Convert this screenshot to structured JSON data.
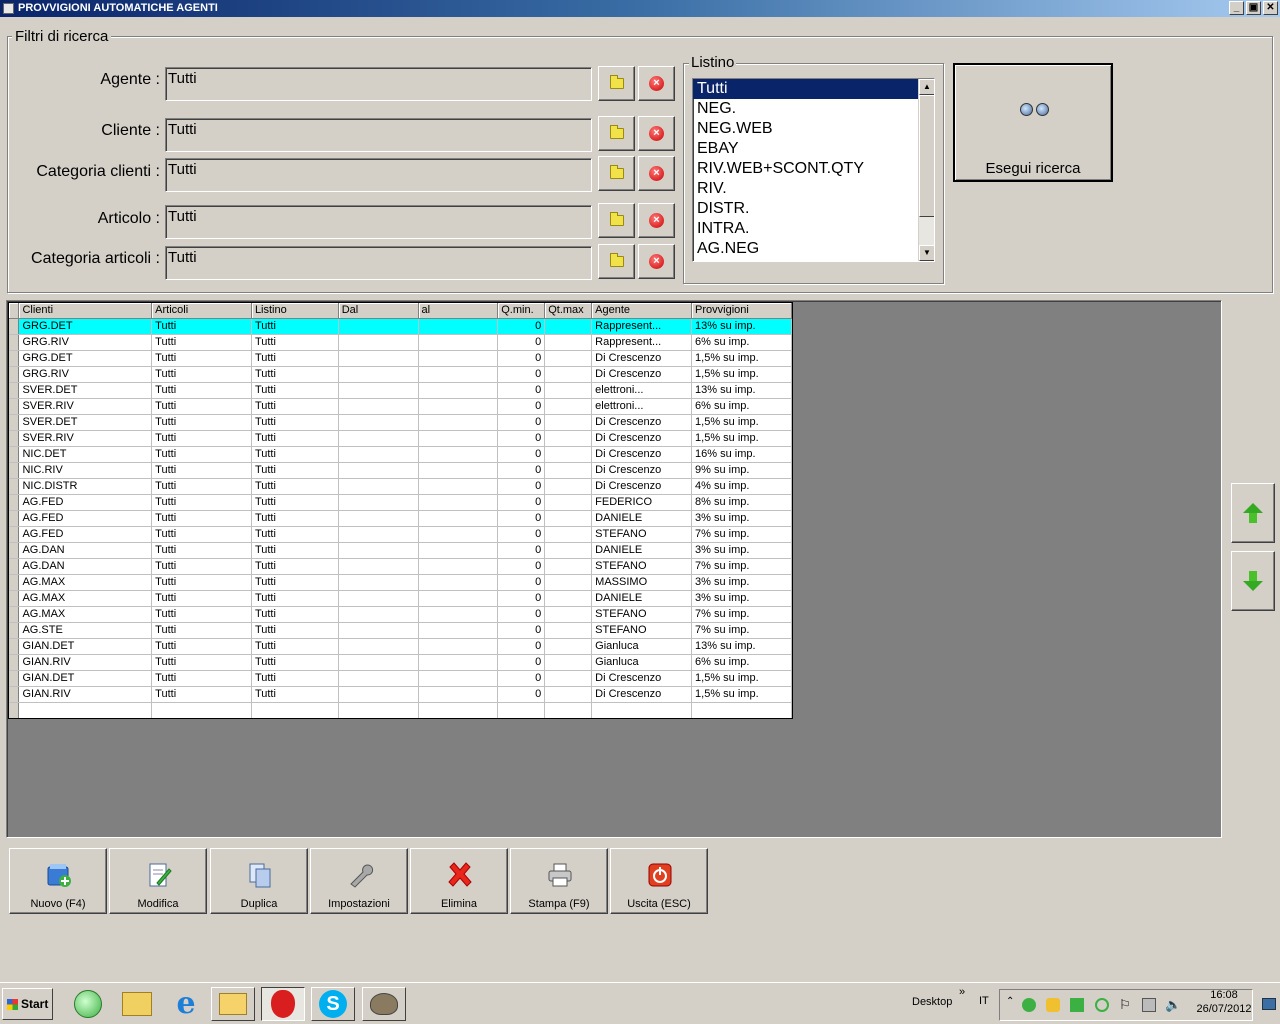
{
  "window": {
    "title": "PROVVIGIONI AUTOMATICHE AGENTI",
    "btn_min": "_",
    "btn_restore": "▣",
    "btn_close": "✕"
  },
  "filters": {
    "group_title": "Filtri di ricerca",
    "agente_label": "Agente :",
    "agente_value": "Tutti",
    "cliente_label": "Cliente :",
    "cliente_value": "Tutti",
    "catcli_label": "Categoria clienti :",
    "catcli_value": "Tutti",
    "articolo_label": "Articolo :",
    "articolo_value": "Tutti",
    "catart_label": "Categoria articoli :",
    "catart_value": "Tutti"
  },
  "listino": {
    "title": "Listino",
    "items": [
      "Tutti",
      "NEG.",
      "NEG.WEB",
      "EBAY",
      "RIV.WEB+SCONT.QTY",
      "RIV.",
      "DISTR.",
      "INTRA.",
      "AG.NEG"
    ],
    "selected_index": 0
  },
  "search": {
    "label": "Esegui ricerca",
    "icon": "binoculars-icon"
  },
  "grid": {
    "columns": [
      "Clienti",
      "Articoli",
      "Listino",
      "Dal",
      "al",
      "Q.min.",
      "Qt.max",
      "Agente",
      "Provvigioni"
    ],
    "rows": [
      [
        "GRG.DET",
        "Tutti",
        "Tutti",
        "",
        "",
        "0",
        "",
        "Rappresent...",
        "13% su imp."
      ],
      [
        "GRG.RIV",
        "Tutti",
        "Tutti",
        "",
        "",
        "0",
        "",
        "Rappresent...",
        "6% su imp."
      ],
      [
        "GRG.DET",
        "Tutti",
        "Tutti",
        "",
        "",
        "0",
        "",
        "Di Crescenzo",
        "1,5% su imp."
      ],
      [
        "GRG.RIV",
        "Tutti",
        "Tutti",
        "",
        "",
        "0",
        "",
        "Di Crescenzo",
        "1,5% su imp."
      ],
      [
        "SVER.DET",
        "Tutti",
        "Tutti",
        "",
        "",
        "0",
        "",
        "elettroni...",
        "13% su imp."
      ],
      [
        "SVER.RIV",
        "Tutti",
        "Tutti",
        "",
        "",
        "0",
        "",
        "elettroni...",
        "6% su imp."
      ],
      [
        "SVER.DET",
        "Tutti",
        "Tutti",
        "",
        "",
        "0",
        "",
        "Di Crescenzo",
        "1,5% su imp."
      ],
      [
        "SVER.RIV",
        "Tutti",
        "Tutti",
        "",
        "",
        "0",
        "",
        "Di Crescenzo",
        "1,5% su imp."
      ],
      [
        "NIC.DET",
        "Tutti",
        "Tutti",
        "",
        "",
        "0",
        "",
        "Di Crescenzo",
        "16% su imp."
      ],
      [
        "NIC.RIV",
        "Tutti",
        "Tutti",
        "",
        "",
        "0",
        "",
        "Di Crescenzo",
        "9% su imp."
      ],
      [
        "NIC.DISTR",
        "Tutti",
        "Tutti",
        "",
        "",
        "0",
        "",
        "Di Crescenzo",
        "4% su imp."
      ],
      [
        "AG.FED",
        "Tutti",
        "Tutti",
        "",
        "",
        "0",
        "",
        "FEDERICO",
        "8% su imp."
      ],
      [
        "AG.FED",
        "Tutti",
        "Tutti",
        "",
        "",
        "0",
        "",
        "DANIELE",
        "3% su imp."
      ],
      [
        "AG.FED",
        "Tutti",
        "Tutti",
        "",
        "",
        "0",
        "",
        "STEFANO",
        "7% su imp."
      ],
      [
        "AG.DAN",
        "Tutti",
        "Tutti",
        "",
        "",
        "0",
        "",
        "DANIELE",
        "3% su imp."
      ],
      [
        "AG.DAN",
        "Tutti",
        "Tutti",
        "",
        "",
        "0",
        "",
        "STEFANO",
        "7% su imp."
      ],
      [
        "AG.MAX",
        "Tutti",
        "Tutti",
        "",
        "",
        "0",
        "",
        "MASSIMO",
        "3% su imp."
      ],
      [
        "AG.MAX",
        "Tutti",
        "Tutti",
        "",
        "",
        "0",
        "",
        "DANIELE",
        "3% su imp."
      ],
      [
        "AG.MAX",
        "Tutti",
        "Tutti",
        "",
        "",
        "0",
        "",
        "STEFANO",
        "7% su imp."
      ],
      [
        "AG.STE",
        "Tutti",
        "Tutti",
        "",
        "",
        "0",
        "",
        "STEFANO",
        "7% su imp."
      ],
      [
        "GIAN.DET",
        "Tutti",
        "Tutti",
        "",
        "",
        "0",
        "",
        "Gianluca",
        "13% su imp."
      ],
      [
        "GIAN.RIV",
        "Tutti",
        "Tutti",
        "",
        "",
        "0",
        "",
        "Gianluca",
        "6% su imp."
      ],
      [
        "GIAN.DET",
        "Tutti",
        "Tutti",
        "",
        "",
        "0",
        "",
        "Di Crescenzo",
        "1,5% su imp."
      ],
      [
        "GIAN.RIV",
        "Tutti",
        "Tutti",
        "",
        "",
        "0",
        "",
        "Di Crescenzo",
        "1,5% su imp."
      ]
    ],
    "selected_row": 0
  },
  "toolbar": {
    "nuovo": "Nuovo (F4)",
    "modifica": "Modifica",
    "duplica": "Duplica",
    "impostazioni": "Impostazioni",
    "elimina": "Elimina",
    "stampa": "Stampa (F9)",
    "uscita": "Uscita (ESC)"
  },
  "taskbar": {
    "start": "Start",
    "desktop": "Desktop",
    "lang": "IT",
    "time": "16:08",
    "date": "26/07/2012"
  },
  "colors": {
    "selection": "#0a246a",
    "row_highlight": "#00ffff",
    "face": "#d4d0c8"
  }
}
